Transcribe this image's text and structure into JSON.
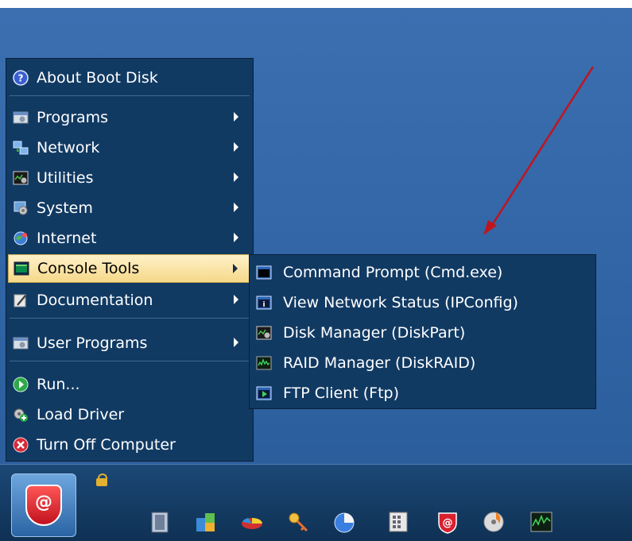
{
  "start_menu": {
    "items": [
      {
        "label": "About Boot Disk",
        "icon": "help-icon"
      },
      {
        "label": "Programs",
        "icon": "programs-icon"
      },
      {
        "label": "Network",
        "icon": "network-icon"
      },
      {
        "label": "Utilities",
        "icon": "utilities-icon"
      },
      {
        "label": "System",
        "icon": "system-icon"
      },
      {
        "label": "Internet",
        "icon": "internet-icon"
      },
      {
        "label": "Console Tools",
        "icon": "console-icon"
      },
      {
        "label": "Documentation",
        "icon": "documentation-icon"
      },
      {
        "label": "User Programs",
        "icon": "user-programs-icon"
      },
      {
        "label": "Run...",
        "icon": "run-icon"
      },
      {
        "label": "Load Driver",
        "icon": "load-driver-icon"
      },
      {
        "label": "Turn Off Computer",
        "icon": "power-off-icon"
      }
    ]
  },
  "console_submenu": {
    "items": [
      {
        "label": "Command Prompt (Cmd.exe)",
        "icon": "command-prompt-icon"
      },
      {
        "label": "View Network Status (IPConfig)",
        "icon": "network-status-icon"
      },
      {
        "label": "Disk Manager (DiskPart)",
        "icon": "disk-manager-icon"
      },
      {
        "label": "RAID Manager (DiskRAID)",
        "icon": "raid-manager-icon"
      },
      {
        "label": "FTP Client (Ftp)",
        "icon": "ftp-client-icon"
      }
    ]
  },
  "taskbar": {
    "start_logo": "@"
  },
  "colors": {
    "desktop": "#2f63a3",
    "menu_bg": "#113a63",
    "highlight": "#f5d889",
    "annotation_arrow": "#c0151e"
  }
}
